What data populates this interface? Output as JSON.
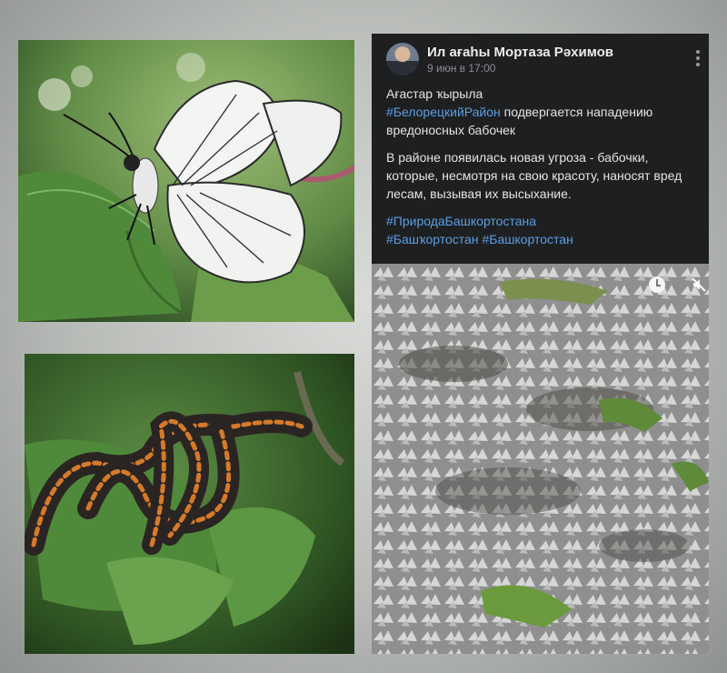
{
  "post": {
    "author": "Ил ағаhы Мортаза Рәхимов",
    "date": "9 июн в 17:00",
    "line1": "Ағастар ҡырыла",
    "hashtag_region": "#БелорецкийРайон",
    "line2_rest": " подвергается нападению вредоносных бабочек",
    "paragraph2": "В районе появилась новая угроза - бабочки, которые, несмотря на свою красоту, наносят вред лесам, вызывая их высыхание.",
    "hashtags": [
      "#ПриродаБашкортостана",
      "#Башҡортостан",
      "#Башкортостан"
    ]
  },
  "icons": {
    "menu": "more-vertical-icon",
    "clock": "clock-icon",
    "mute": "volume-off-icon"
  },
  "colors": {
    "post_background": "#1e1f21",
    "hashtag": "#5a9fe0",
    "page_background": "#c4c6c3"
  }
}
